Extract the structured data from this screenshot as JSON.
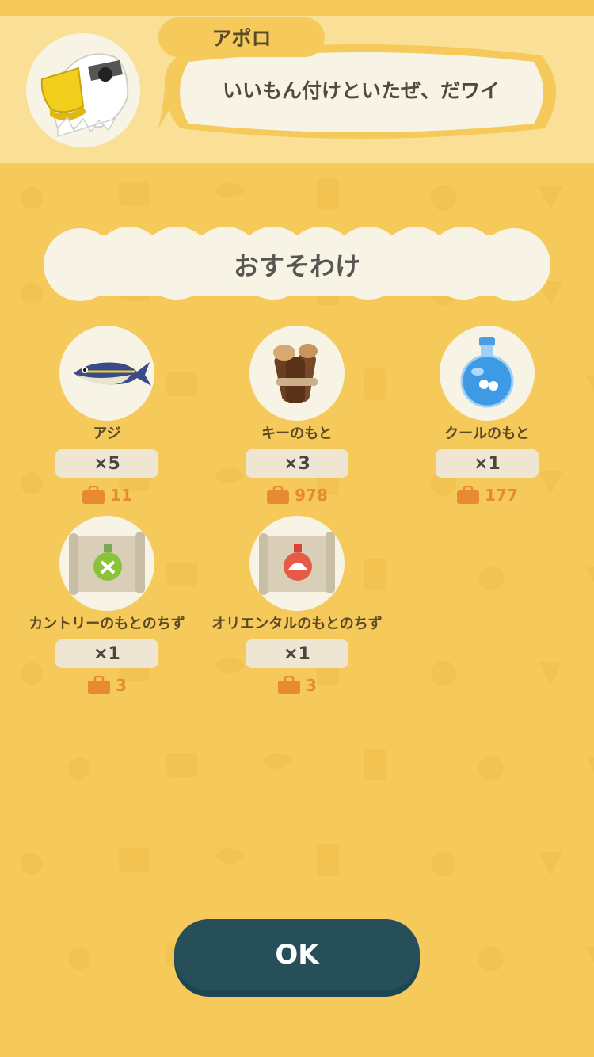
{
  "dialog": {
    "speaker_name": "アポロ",
    "message": "いいもん付けといたぜ、だワイ"
  },
  "title": "おすそわけ",
  "items": [
    {
      "name": "アジ",
      "quantity": "×5",
      "price": "11",
      "icon": "horse-mackerel-fish-icon"
    },
    {
      "name": "キーのもと",
      "quantity": "×3",
      "price": "978",
      "icon": "wood-bundle-icon"
    },
    {
      "name": "クールのもと",
      "quantity": "×1",
      "price": "177",
      "icon": "blue-potion-icon"
    },
    {
      "name": "カントリーのもとのちず",
      "quantity": "×1",
      "price": "3",
      "icon": "country-essence-map-icon"
    },
    {
      "name": "オリエンタルのもとのちず",
      "quantity": "×1",
      "price": "3",
      "icon": "oriental-essence-map-icon"
    }
  ],
  "ok_label": "OK",
  "colors": {
    "background": "#f5c95a",
    "header": "#fae096",
    "cream": "#f7f4e6",
    "button": "#264f5a",
    "price": "#e78a32"
  }
}
